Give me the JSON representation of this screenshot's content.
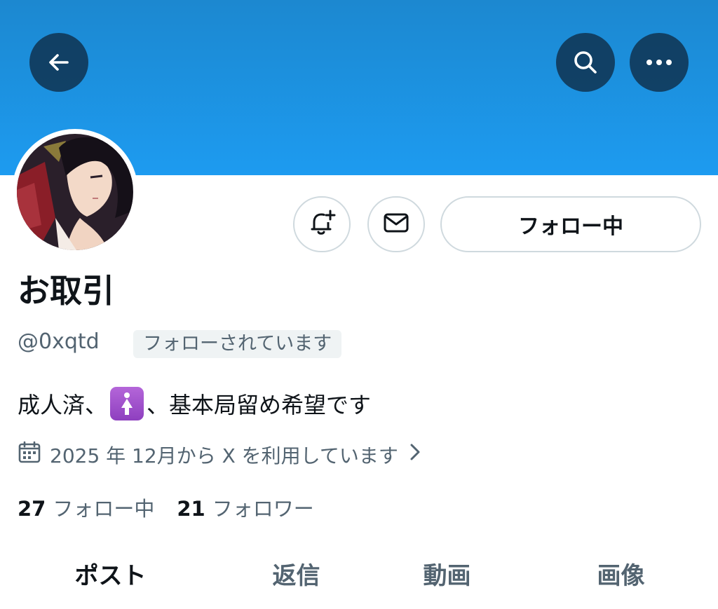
{
  "header": {
    "back_icon": "arrow-left-icon",
    "search_icon": "search-icon",
    "more_icon": "more-horizontal-icon",
    "banner_color": "#1d9bf0"
  },
  "actions": {
    "notify_icon": "bell-plus-icon",
    "message_icon": "envelope-icon",
    "follow_label": "フォロー中"
  },
  "profile": {
    "name": "お取引",
    "handle": "@0xqtd",
    "follows_you": "フォローされています",
    "bio_before": "成人済、",
    "bio_emoji": "🚺",
    "bio_after": "、基本局留め希望です",
    "joined": "2025 年 12月から X を利用しています"
  },
  "stats": {
    "following_count": "27",
    "following_label": "フォロー中",
    "followers_count": "21",
    "followers_label": "フォロワー"
  },
  "tabs": [
    {
      "label": "ポスト",
      "active": true
    },
    {
      "label": "返信",
      "active": false
    },
    {
      "label": "動画",
      "active": false
    },
    {
      "label": "画像",
      "active": false
    }
  ]
}
